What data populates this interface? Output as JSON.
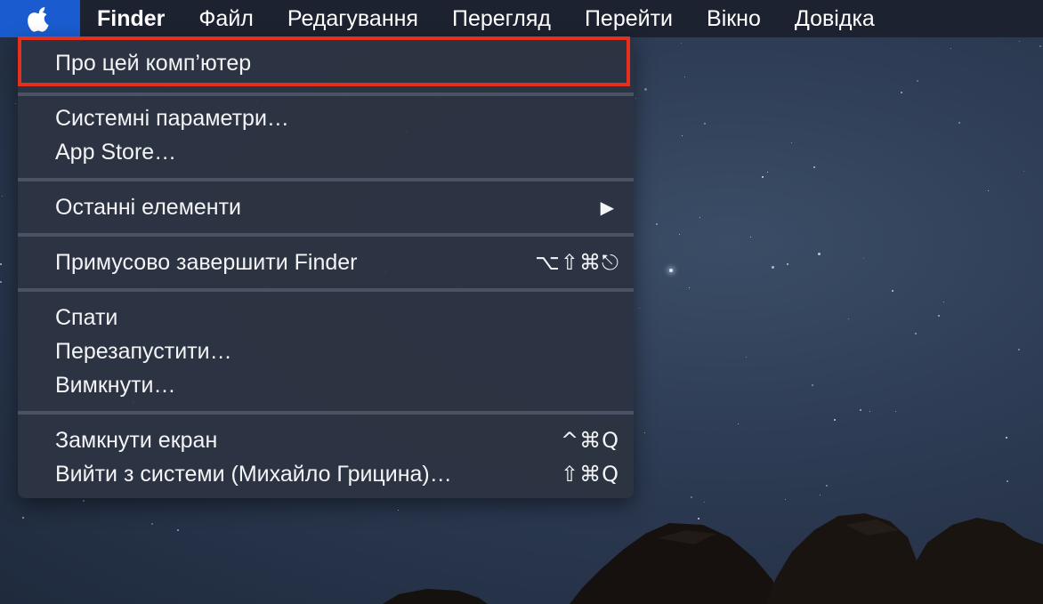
{
  "menubar": {
    "app_name": "Finder",
    "menus": [
      "Файл",
      "Редагування",
      "Перегляд",
      "Перейти",
      "Вікно",
      "Довідка"
    ]
  },
  "apple_menu": {
    "about": "Про цей комп’ютер",
    "system_prefs": "Системні параметри…",
    "app_store": "App Store…",
    "recent_items": "Останні елементи",
    "force_quit": "Примусово завершити Finder",
    "force_quit_shortcut": "⌥⇧⌘⎋",
    "sleep": "Спати",
    "restart": "Перезапустити…",
    "shutdown": "Вимкнути…",
    "lock_screen": "Замкнути екран",
    "lock_screen_shortcut": "^⌘Q",
    "logout": "Вийти з системи (Михайло Грицина)…",
    "logout_shortcut": "⇧⌘Q"
  },
  "colors": {
    "apple_highlight": "#1a5ccf",
    "annotation_box": "#e4301d"
  },
  "icons": {
    "apple": "apple-logo-icon",
    "submenu": "triangle-right-icon"
  }
}
